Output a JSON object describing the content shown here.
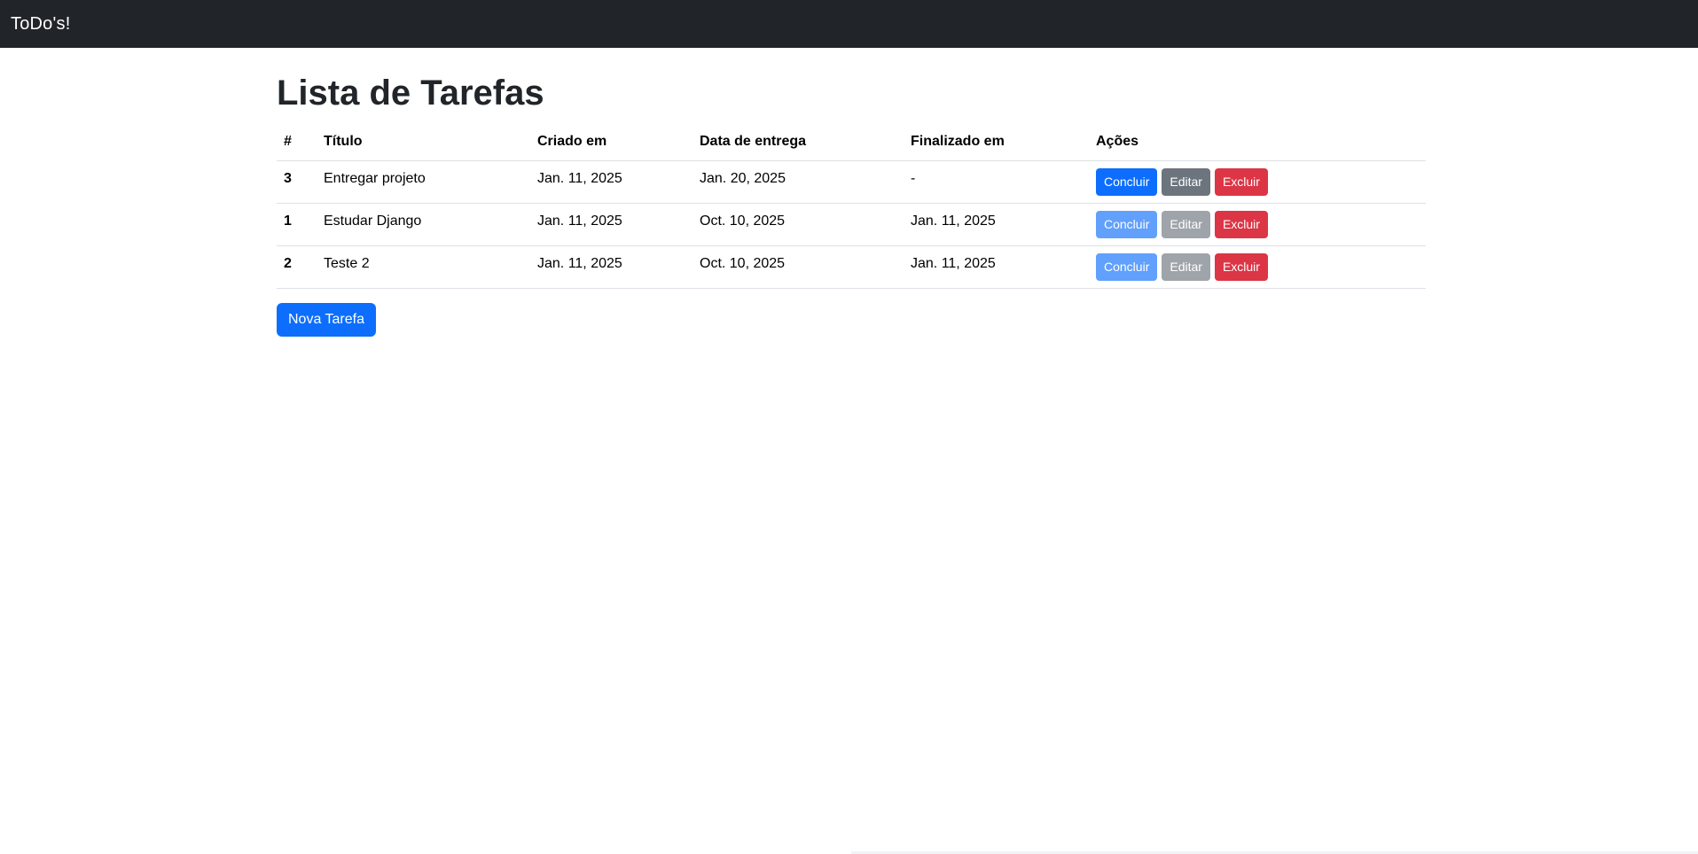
{
  "navbar": {
    "brand": "ToDo's!"
  },
  "page": {
    "title": "Lista de Tarefas"
  },
  "table": {
    "headers": [
      "#",
      "Título",
      "Criado em",
      "Data de entrega",
      "Finalizado em",
      "Ações"
    ],
    "rows": [
      {
        "id": "3",
        "title": "Entregar projeto",
        "created": "Jan. 11, 2025",
        "due": "Jan. 20, 2025",
        "finished": "-",
        "done": false
      },
      {
        "id": "1",
        "title": "Estudar Django",
        "created": "Jan. 11, 2025",
        "due": "Oct. 10, 2025",
        "finished": "Jan. 11, 2025",
        "done": true
      },
      {
        "id": "2",
        "title": "Teste 2",
        "created": "Jan. 11, 2025",
        "due": "Oct. 10, 2025",
        "finished": "Jan. 11, 2025",
        "done": true
      }
    ]
  },
  "actions": {
    "complete": "Concluir",
    "edit": "Editar",
    "delete": "Excluir"
  },
  "new_task_button": "Nova Tarefa",
  "colors": {
    "navbar": "#212529",
    "primary": "#0d6efd",
    "secondary": "#6c757d",
    "danger": "#dc3545"
  }
}
